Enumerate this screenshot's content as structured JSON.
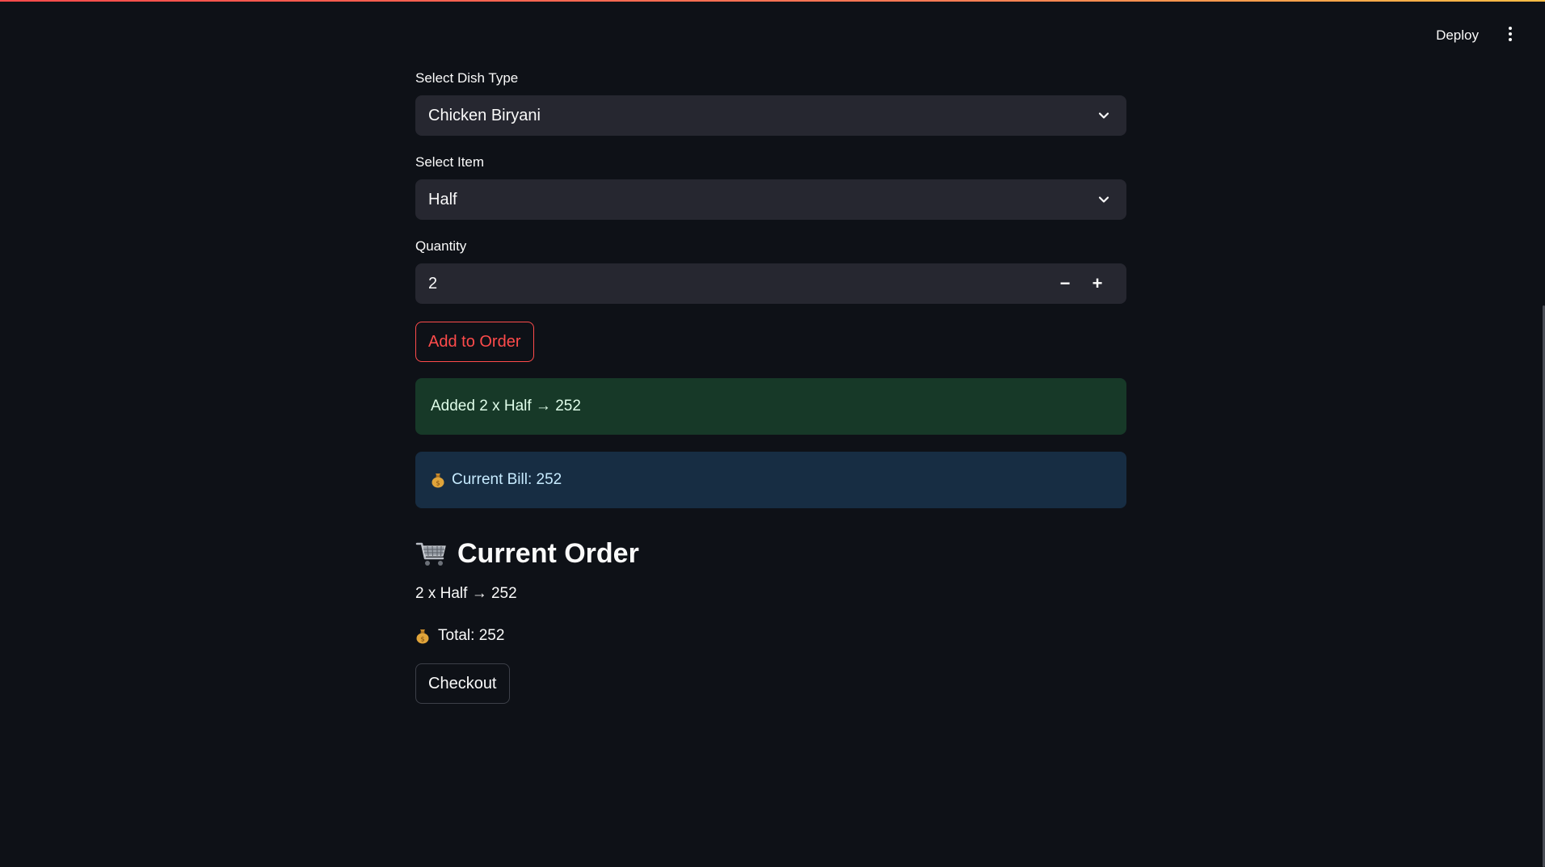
{
  "header": {
    "deploy_label": "Deploy",
    "menu_icon": "kebab-menu-icon"
  },
  "form": {
    "dish_type": {
      "label": "Select Dish Type",
      "selected": "Chicken Biryani"
    },
    "item": {
      "label": "Select Item",
      "selected": "Half"
    },
    "quantity": {
      "label": "Quantity",
      "value": "2",
      "decrement_label": "−",
      "increment_label": "+"
    },
    "add_button_label": "Add to Order"
  },
  "alerts": {
    "success_text": "Added 2 x Half → 252",
    "info_text": "Current Bill: 252"
  },
  "order": {
    "heading": "Current Order",
    "lines": [
      "2 x Half → 252"
    ],
    "total_text": "Total: 252",
    "checkout_label": "Checkout"
  },
  "colors": {
    "background": "#0e1117",
    "accent": "#ff4b4b",
    "success_bg": "#173928",
    "info_bg": "#172d43",
    "input_bg": "#262730"
  }
}
